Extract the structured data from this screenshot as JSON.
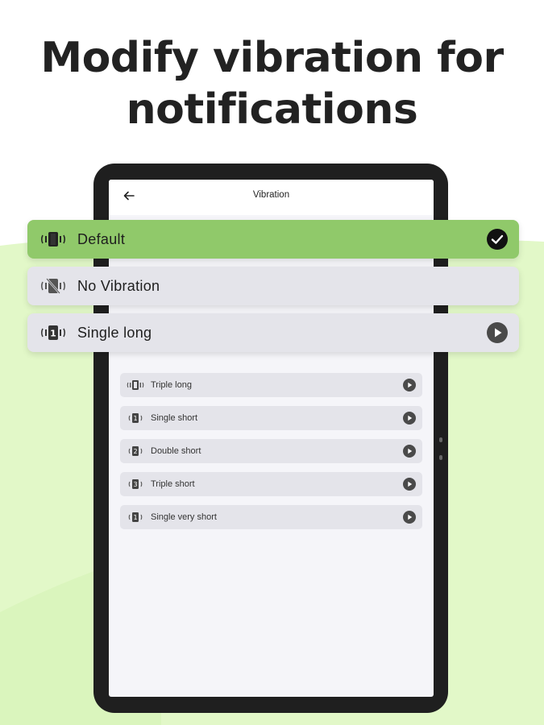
{
  "headline": {
    "line1": "Modify vibration for",
    "line2": "notifications"
  },
  "screen": {
    "title": "Vibration",
    "back_icon": "arrow-left-icon"
  },
  "featured_options": [
    {
      "label": "Default",
      "selected": true,
      "end_icon": "check-circle-icon"
    },
    {
      "label": "No Vibration",
      "selected": false,
      "end_icon": ""
    },
    {
      "label": "Single long",
      "selected": false,
      "end_icon": "play-circle-icon",
      "badge": "1"
    }
  ],
  "options": [
    {
      "label": "Triple long",
      "badge": ""
    },
    {
      "label": "Single short",
      "badge": "1"
    },
    {
      "label": "Double short",
      "badge": "2"
    },
    {
      "label": "Triple short",
      "badge": "3"
    },
    {
      "label": "Single very short",
      "badge": "1"
    }
  ],
  "colors": {
    "accent": "#90c96a",
    "background_wave": "#e2f8c8",
    "item_bg": "#e4e4ea",
    "tablet": "#1f1f1f"
  }
}
